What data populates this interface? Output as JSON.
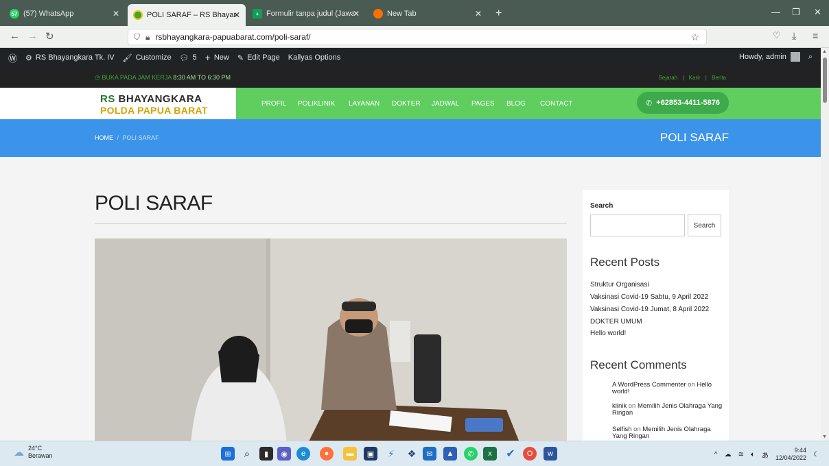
{
  "browser": {
    "tabs": [
      {
        "label": "(57) WhatsApp",
        "badge": "57",
        "color": "#25d366"
      },
      {
        "label": "POLI SARAF – RS Bhayangkara",
        "color": "#3aa53a"
      },
      {
        "label": "Formulir tanpa judul (Jawaban)",
        "color": "#0f9d58"
      },
      {
        "label": "New Tab",
        "color": "#ff6f00"
      }
    ],
    "url": "rsbhayangkara-papuabarat.com/poli-saraf/"
  },
  "wp_admin": {
    "site_name": "RS Bhayangkara Tk. IV",
    "customize": "Customize",
    "comments_count": "5",
    "new_label": "New",
    "edit_page": "Edit Page",
    "kallyas": "Kallyas Options",
    "howdy": "Howdy, admin"
  },
  "topbar": {
    "hours_prefix": "BUKA PADA JAM KERJA",
    "hours_value": "8:30 AM TO 6:30 PM",
    "links": [
      "Sejarah",
      "Karir",
      "Berita"
    ]
  },
  "header": {
    "logo_line1_rs": "RS",
    "logo_line1": "BHAYANGKARA",
    "logo_line2": "POLDA PAPUA BARAT",
    "menu": [
      "PROFIL",
      "POLIKLINIK",
      "LAYANAN",
      "DOKTER",
      "JADWAL",
      "PAGES",
      "BLOG",
      "CONTACT"
    ],
    "phone": "+62853-4411-5876"
  },
  "breadcrumb": {
    "home": "HOME",
    "separator": "/",
    "current": "POLI SARAF",
    "title": "POLI SARAF"
  },
  "page": {
    "title": "POLI SARAF"
  },
  "sidebar": {
    "search_label": "Search",
    "search_placeholder": "",
    "search_button": "Search",
    "recent_posts_title": "Recent Posts",
    "recent_posts": [
      "Struktur Organisasi",
      "Vaksinasi Covid-19 Sabtu, 9 April 2022",
      "Vaksinasi Covid-19 Jumat, 8 April 2022",
      "DOKTER UMUM",
      "Hello world!"
    ],
    "recent_comments_title": "Recent Comments",
    "recent_comments": [
      {
        "author": "A WordPress Commenter",
        "on": "on",
        "post": "Hello world!"
      },
      {
        "author": "klinik",
        "on": "on",
        "post": "Memilih Jenis Olahraga Yang Ringan"
      },
      {
        "author": "Selfish",
        "on": "on",
        "post": "Memilih Jenis Olahraga Yang Ringan"
      }
    ]
  },
  "taskbar": {
    "temperature": "24°C",
    "weather": "Berawan",
    "time": "9:44",
    "date": "12/04/2022"
  }
}
